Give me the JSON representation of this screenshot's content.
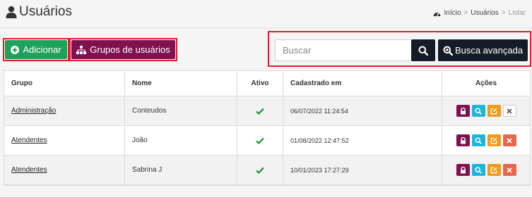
{
  "header": {
    "title": "Usuários",
    "breadcrumb": [
      "Início",
      "Usuários",
      "Listar"
    ]
  },
  "toolbar": {
    "add_label": "Adicionar",
    "groups_label": "Grupos de usuários",
    "search_placeholder": "Buscar",
    "advanced_search_label": "Busca avançada"
  },
  "table": {
    "columns": [
      "Grupo",
      "Nome",
      "Ativo",
      "Cadastrado em",
      "Ações"
    ],
    "rows": [
      {
        "grupo": "Administração",
        "nome": "Conteudos",
        "ativo": true,
        "cadastrado": "06/07/2022 11:24:54",
        "deletable": false
      },
      {
        "grupo": "Atendentes",
        "nome": "João",
        "ativo": true,
        "cadastrado": "01/08/2022 12:47:52",
        "deletable": true
      },
      {
        "grupo": "Atendentes",
        "nome": "Sabrina J",
        "ativo": true,
        "cadastrado": "10/01/2023 17:27:29",
        "deletable": true
      }
    ]
  },
  "colors": {
    "add": "#1ea15a",
    "groups": "#7f1150",
    "dark": "#141d27",
    "check": "#2a9d3f",
    "highlight": "#e11d2b"
  },
  "icons": [
    "user-icon",
    "dashboard-icon",
    "plus-circle-icon",
    "sitemap-icon",
    "search-icon",
    "search-plus-icon",
    "check-icon",
    "lock-icon",
    "edit-icon",
    "close-icon"
  ]
}
